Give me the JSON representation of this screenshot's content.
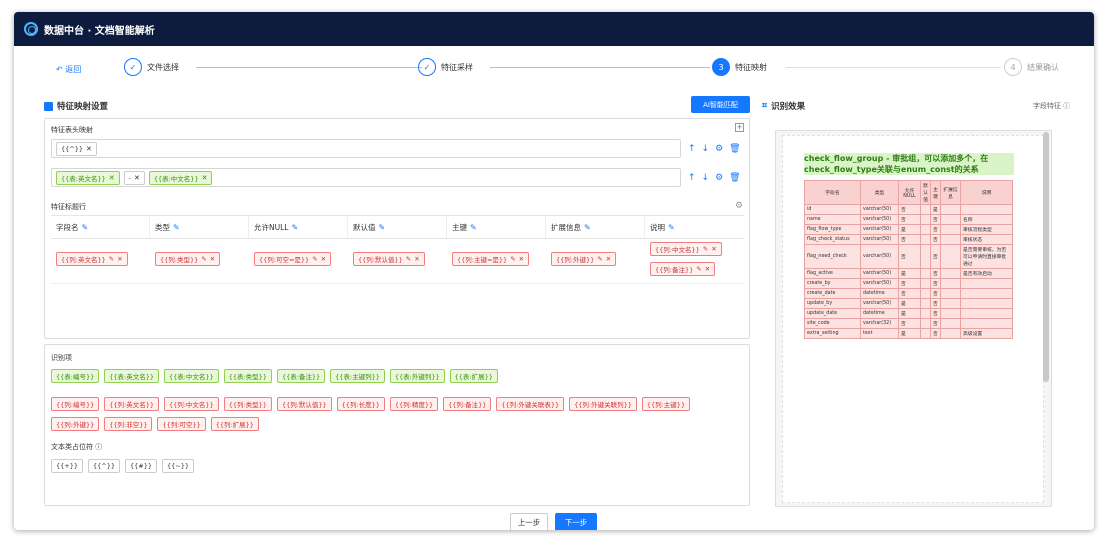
{
  "app": {
    "title": "数据中台 · 文档智能解析"
  },
  "steps": {
    "back": "返回",
    "items": [
      {
        "num": "✓",
        "label": "文件选择"
      },
      {
        "num": "✓",
        "label": "特征采样"
      },
      {
        "num": "3",
        "label": "特征映射"
      },
      {
        "num": "4",
        "label": "结果确认"
      }
    ]
  },
  "left": {
    "title": "特征映射设置",
    "ai_button": "AI智能匹配",
    "table_header_label": "特征表头映射",
    "row1_tag": "{{^}}",
    "row2_tags": [
      "{{表:英文名}}",
      "-",
      "{{表:中文名}}"
    ],
    "col_header_label": "特征标题行",
    "columns": [
      "字段名",
      "类型",
      "允许NULL",
      "默认值",
      "主键",
      "扩展信息",
      "说明"
    ],
    "cells": [
      "{{列:英文名}}",
      "{{列:类型}}",
      "{{列:可空=是}}",
      "{{列:默认值}}",
      "{{列:主键=是}}",
      "{{列:外键}}",
      "{{列:中文名}}",
      "{{列:备注}}"
    ]
  },
  "recog": {
    "title": "识别项",
    "green": [
      "{{表:编号}}",
      "{{表:英文名}}",
      "{{表:中文名}}",
      "{{表:类型}}",
      "{{表:备注}}",
      "{{表:主键列}}",
      "{{表:外键列}}",
      "{{表:扩展}}"
    ],
    "red1": [
      "{{列:编号}}",
      "{{列:英文名}}",
      "{{列:中文名}}",
      "{{列:类型}}",
      "{{列:默认值}}",
      "{{列:长度}}",
      "{{列:精度}}",
      "{{列:备注}}",
      "{{列:外键关联表}}",
      "{{列:外键关联列}}",
      "{{列:主键}}"
    ],
    "red2": [
      "{{列:外键}}",
      "{{列:非空}}",
      "{{列:可空}}",
      "{{列:扩展}}"
    ],
    "placeholder_title": "文本类占位符",
    "placeholders": [
      "{{+}}",
      "{{^}}",
      "{{#}}",
      "{{~}}"
    ]
  },
  "right": {
    "title": "识别效果",
    "link": "字段特征",
    "preview_title": "check_flow_group - 审批组，可以添加多个，在check_flow_type关联与enum_const的关系",
    "headers": [
      "字段名",
      "类型",
      "允许NULL",
      "默认值",
      "主键",
      "扩展信息",
      "说明"
    ],
    "rows": [
      [
        "id",
        "varchar(50)",
        "否",
        "",
        "是",
        "",
        ""
      ],
      [
        "name",
        "varchar(50)",
        "否",
        "",
        "否",
        "",
        "名称"
      ],
      [
        "flag_flow_type",
        "varchar(50)",
        "是",
        "",
        "否",
        "",
        "审核流程类型"
      ],
      [
        "flag_check_status",
        "varchar(50)",
        "否",
        "",
        "否",
        "",
        "审核状态"
      ],
      [
        "flag_need_check",
        "varchar(50)",
        "否",
        "",
        "否",
        "",
        "是否需要审核，为否可以申请时直接审批通过"
      ],
      [
        "flag_active",
        "varchar(50)",
        "是",
        "",
        "否",
        "",
        "是否有效启动"
      ],
      [
        "create_by",
        "varchar(50)",
        "否",
        "",
        "否",
        "",
        ""
      ],
      [
        "create_date",
        "datetime",
        "否",
        "",
        "否",
        "",
        ""
      ],
      [
        "update_by",
        "varchar(50)",
        "是",
        "",
        "否",
        "",
        ""
      ],
      [
        "update_date",
        "datetime",
        "是",
        "",
        "否",
        "",
        ""
      ],
      [
        "site_code",
        "varchar(32)",
        "否",
        "",
        "否",
        "",
        ""
      ],
      [
        "extra_setting",
        "text",
        "是",
        "",
        "否",
        "",
        "高级设置"
      ]
    ]
  },
  "footer": {
    "prev": "上一步",
    "next": "下一步"
  }
}
